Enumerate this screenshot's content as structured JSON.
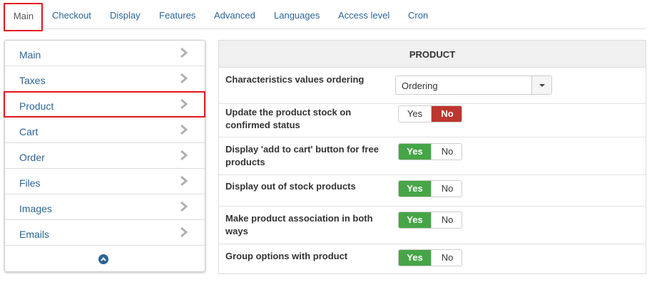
{
  "tabs": [
    "Main",
    "Checkout",
    "Display",
    "Features",
    "Advanced",
    "Languages",
    "Access level",
    "Cron"
  ],
  "sidebar": {
    "items": [
      "Main",
      "Taxes",
      "Product",
      "Cart",
      "Order",
      "Files",
      "Images",
      "Emails"
    ],
    "footer_icon": "chevron-up-circle-icon",
    "item_icon": "chevron-right-icon"
  },
  "panel": {
    "title": "PRODUCT",
    "ordering": {
      "label": "Characteristics values ordering",
      "value": "Ordering"
    },
    "toggles": [
      {
        "label": "Update the product stock on confirmed status",
        "yes": "Yes",
        "no": "No",
        "selected": "no"
      },
      {
        "label": "Display 'add to cart' button for free products",
        "yes": "Yes",
        "no": "No",
        "selected": "yes"
      },
      {
        "label": "Display out of stock products",
        "yes": "Yes",
        "no": "No",
        "selected": "yes"
      },
      {
        "label": "Make product association in both ways",
        "yes": "Yes",
        "no": "No",
        "selected": "yes"
      },
      {
        "label": "Group options with product",
        "yes": "Yes",
        "no": "No",
        "selected": "yes"
      }
    ]
  },
  "colors": {
    "link": "#2a6496",
    "yes_active": "#46a546",
    "no_active": "#bd362f",
    "highlight": "#e4161d"
  }
}
